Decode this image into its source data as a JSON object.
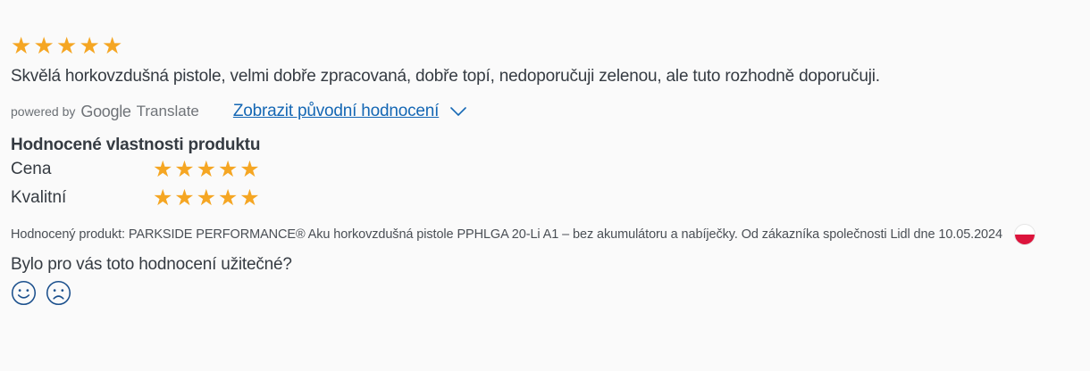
{
  "review": {
    "overall_rating": 5,
    "overall_max": 5,
    "text": "Skvělá horkovzdušná pistole, velmi dobře zpracovaná, dobře topí, nedoporučuji zelenou, ale tuto rozhodně doporučuji."
  },
  "translation": {
    "powered_by": "powered by",
    "google": "Google",
    "translate": "Translate",
    "show_original": "Zobrazit původní hodnocení"
  },
  "properties": {
    "title": "Hodnocené vlastnosti produktu",
    "items": [
      {
        "label": "Cena",
        "rating": 5
      },
      {
        "label": "Kvalitní",
        "rating": 5
      }
    ]
  },
  "rated_product": "Hodnocený produkt: PARKSIDE PERFORMANCE® Aku horkovzdušná pistole PPHLGA 20-Li A1 – bez akumulátoru a nabíječky. Od zákazníka společnosti Lidl dne 10.05.2024",
  "country_flag": "poland-flag-icon",
  "helpful": {
    "question": "Bylo pro vás toto hodnocení užitečné?"
  },
  "colors": {
    "star": "#f5a623",
    "link": "#1467b4",
    "text": "#353b42",
    "icon_blue": "#1a4f8c"
  }
}
